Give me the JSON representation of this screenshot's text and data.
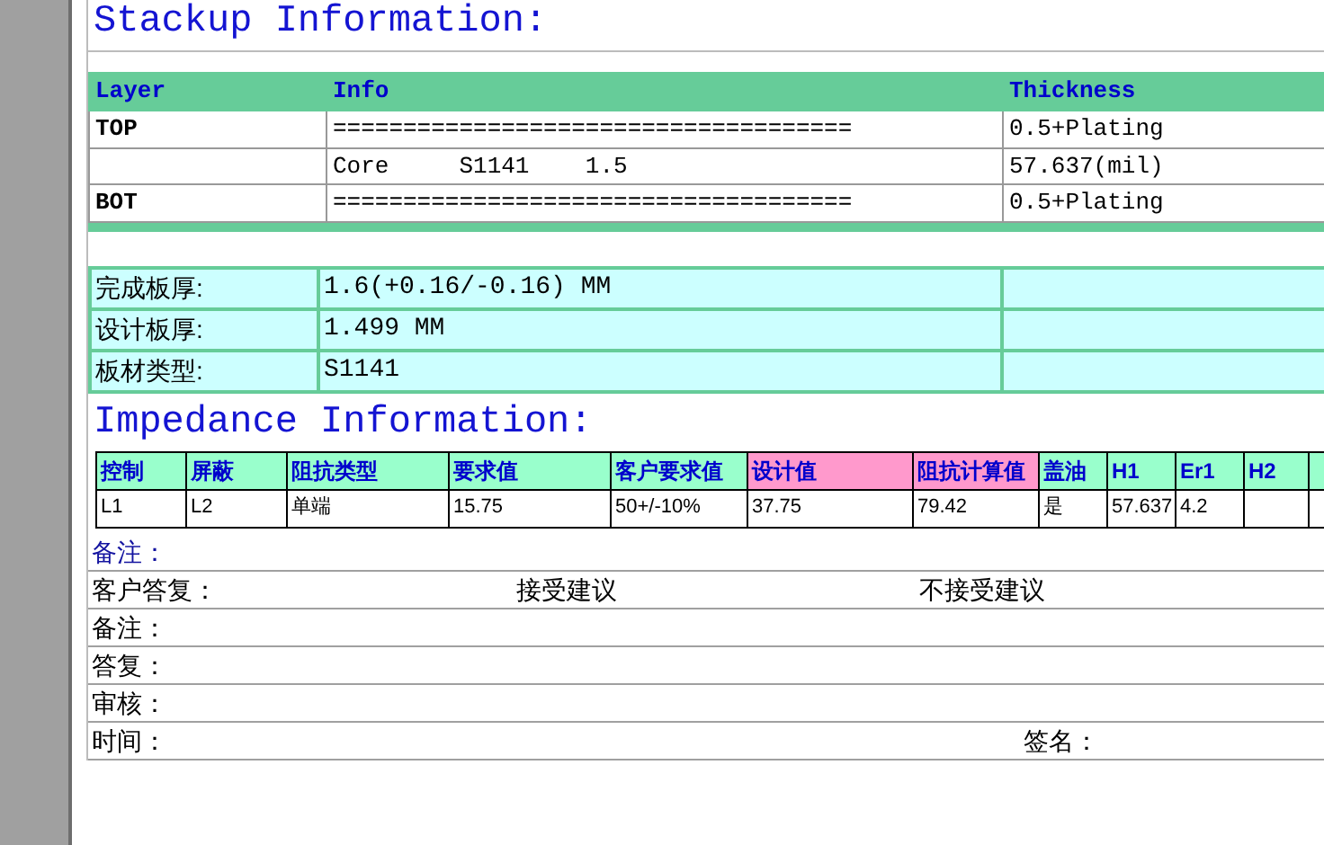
{
  "stackup": {
    "title": "Stackup Information:",
    "columns": [
      "Layer",
      "Info",
      "Thickness"
    ],
    "rows": [
      {
        "layer": "TOP",
        "info": "=====================================",
        "thickness": "0.5+Plating"
      },
      {
        "info": "Core     S1141    1.5",
        "thickness": "57.637(mil)"
      },
      {
        "layer": "BOT",
        "info": "=====================================",
        "thickness": "0.5+Plating"
      }
    ]
  },
  "board": {
    "rows": [
      {
        "label": "完成板厚:",
        "value": "1.6(+0.16/-0.16) MM"
      },
      {
        "label": "设计板厚:",
        "value": "1.499 MM"
      },
      {
        "label": "板材类型:",
        "value": "S1141"
      }
    ]
  },
  "impedance": {
    "title": "Impedance Information:",
    "columns": [
      {
        "label": "控制",
        "highlight": false
      },
      {
        "label": "屏蔽",
        "highlight": false
      },
      {
        "label": "阻抗类型",
        "highlight": false
      },
      {
        "label": "要求值",
        "highlight": false
      },
      {
        "label": "客户要求值",
        "highlight": false
      },
      {
        "label": "设计值",
        "highlight": true
      },
      {
        "label": "阻抗计算值",
        "highlight": true
      },
      {
        "label": "盖油",
        "highlight": false
      },
      {
        "label": "H1",
        "highlight": false
      },
      {
        "label": "Er1",
        "highlight": false
      },
      {
        "label": "H2",
        "highlight": false
      }
    ],
    "rows": [
      [
        "L1",
        "L2",
        "单端",
        "15.75",
        "50+/-10%",
        "37.75",
        "79.42",
        "是",
        "57.637",
        "4.2"
      ]
    ]
  },
  "notes": {
    "heading": "备注：",
    "reply": {
      "label": "客户答复：",
      "option_1": "接受建议",
      "option_2": "不接受建议"
    },
    "lines": [
      "备注：",
      "答复：",
      "审核："
    ],
    "sign": {
      "time": "时间：",
      "signature": "签名："
    }
  }
}
